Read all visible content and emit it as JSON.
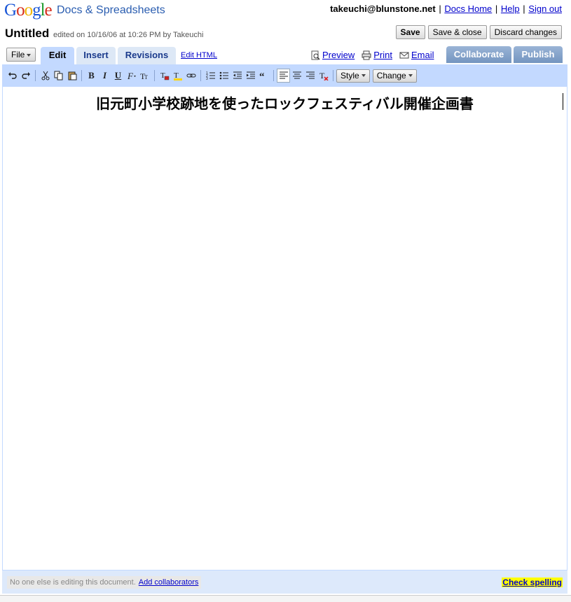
{
  "header": {
    "logo_letters": [
      "G",
      "o",
      "o",
      "g",
      "l",
      "e"
    ],
    "logo_colors": [
      "#1a56d6",
      "#d62c1a",
      "#f0b400",
      "#1a56d6",
      "#1f9a2e",
      "#d62c1a"
    ],
    "product": "Docs & Spreadsheets",
    "user_email": "takeuchi@blunstone.net",
    "links": [
      "Docs Home",
      "Help",
      "Sign out"
    ]
  },
  "document": {
    "title": "Untitled",
    "edited_info": "edited on 10/16/06 at 10:26 PM by Takeuchi",
    "heading": "旧元町小学校跡地を使ったロックフェスティバル開催企画書"
  },
  "actions": {
    "save": "Save",
    "save_close": "Save & close",
    "discard": "Discard changes"
  },
  "tabs": {
    "file": "File",
    "edit": "Edit",
    "insert": "Insert",
    "revisions": "Revisions",
    "edit_html": "Edit HTML",
    "preview": "Preview",
    "print": "Print",
    "email": "Email",
    "collaborate": "Collaborate",
    "publish": "Publish"
  },
  "toolbar": {
    "bold": "B",
    "italic": "I",
    "underline": "U",
    "style": "Style",
    "change": "Change"
  },
  "status": {
    "message": "No one else is editing this document.",
    "add_collaborators": "Add collaborators",
    "check_spelling": "Check spelling"
  }
}
